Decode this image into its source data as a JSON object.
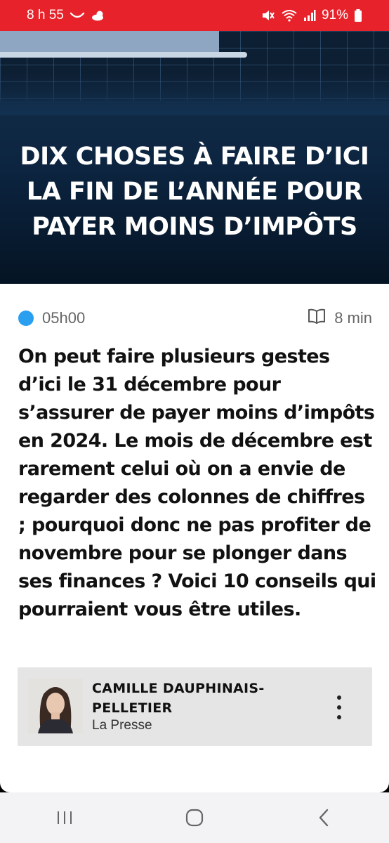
{
  "status_bar": {
    "time": "8 h 55",
    "battery": "91%",
    "icons": [
      "smile-icon",
      "weather-icon",
      "mute-icon",
      "wifi-icon",
      "signal-icon",
      "battery-icon"
    ]
  },
  "hero": {
    "title_lines": [
      "DIX CHOSES À FAIRE D’ICI",
      "LA FIN DE L’ANNÉE POUR",
      "PAYER MOINS D’IMPÔTS"
    ]
  },
  "article": {
    "time": "05h00",
    "read_time": "8 min",
    "lead": "On peut faire plusieurs gestes d’ici le 31 décembre pour s’assurer de payer moins d’impôts en 2024. Le mois de décembre est rarement celui où on a envie de regarder des colonnes de chiffres ; pourquoi donc ne pas profiter de novembre pour se plonger dans ses finances ? Voici 10 conseils qui pourraient vous être utiles."
  },
  "author": {
    "name_line1": "CAMILLE DAUPHINAIS-",
    "name_line2": "PELLETIER",
    "publication": "La Presse"
  },
  "colors": {
    "status_bar": "#e8222a",
    "dot": "#2a9ff0",
    "hero_bg": "#0c2440"
  },
  "nav": {
    "icons": [
      "recent-apps-icon",
      "home-icon",
      "back-icon"
    ]
  }
}
